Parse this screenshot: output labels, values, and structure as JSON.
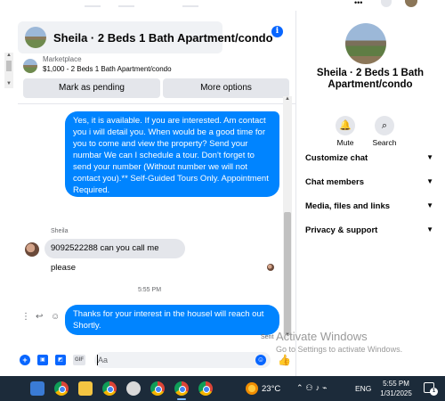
{
  "chat": {
    "header_title": "Sheila · 2 Beds 1 Bath Apartment/condo",
    "info_icon": "i",
    "marketplace_label": "Marketplace",
    "listing_desc": "$1,000 - 2 Beds 1 Bath Apartment/condo",
    "mark_pending_label": "Mark as pending",
    "more_options_label": "More options",
    "messages": [
      {
        "direction": "outgoing",
        "text": "Yes, it is available. If you are interested.  Am contact you i will detail you.  When would be a good time for you to come and view the property? Send your numbar We can I schedule a tour.  Don't forget to send your number (Without number we will not contact you).** Self-Guided Tours Only. Appointment Required."
      },
      {
        "direction": "incoming",
        "sender": "Sheila",
        "text": "9092522288 can you call me please"
      },
      {
        "direction": "outgoing",
        "text": "Thanks for your interest in the housel will reach out Shortly."
      }
    ],
    "timestamp": "5:55 PM",
    "sent_label": "Sent",
    "composer": {
      "placeholder": "Aa",
      "value": "",
      "gif_label": "GIF"
    }
  },
  "info_panel": {
    "title": "Sheila · 2 Beds 1 Bath Apartment/condo",
    "mute_label": "Mute",
    "search_label": "Search",
    "sections": [
      "Customize chat",
      "Chat members",
      "Media, files and links",
      "Privacy & support"
    ]
  },
  "watermark": {
    "line1": "Activate Windows",
    "line2": "Go to Settings to activate Windows."
  },
  "taskbar": {
    "temperature": "23°C",
    "language": "ENG",
    "time": "5:55 PM",
    "date": "1/31/2025",
    "notification_count": "1"
  },
  "colors": {
    "accent": "#0084ff",
    "incoming_bubble": "#e4e6eb",
    "taskbar": "#1c2b3a"
  }
}
